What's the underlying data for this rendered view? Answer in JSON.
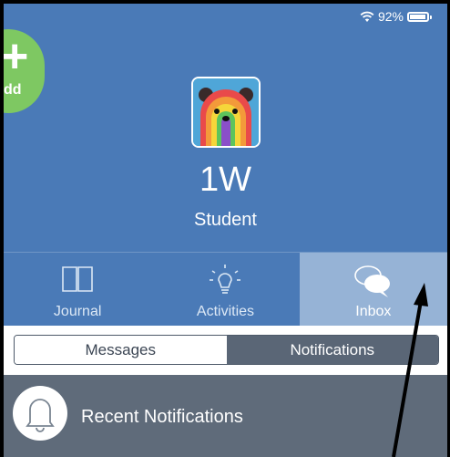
{
  "status": {
    "battery_text": "92%",
    "battery_level": 0.92,
    "icons": [
      "wifi-icon",
      "battery-icon"
    ]
  },
  "add_button": {
    "label": "dd",
    "icon": "plus-icon"
  },
  "profile": {
    "name": "1W",
    "role": "Student",
    "avatar": "rainbow-bear-avatar"
  },
  "tabs": [
    {
      "label": "Journal",
      "icon": "book-icon",
      "active": false
    },
    {
      "label": "Activities",
      "icon": "lightbulb-icon",
      "active": false
    },
    {
      "label": "Inbox",
      "icon": "chat-bubbles-icon",
      "active": true
    }
  ],
  "segments": {
    "messages": "Messages",
    "notifications": "Notifications",
    "selected": "Notifications"
  },
  "recent": {
    "title": "Recent Notifications",
    "icon": "bell-icon"
  },
  "colors": {
    "header_bg": "#4a7ab7",
    "active_tab": "#96b3d6",
    "add_green": "#7ec862",
    "panel_gray": "#5f6b7a"
  }
}
